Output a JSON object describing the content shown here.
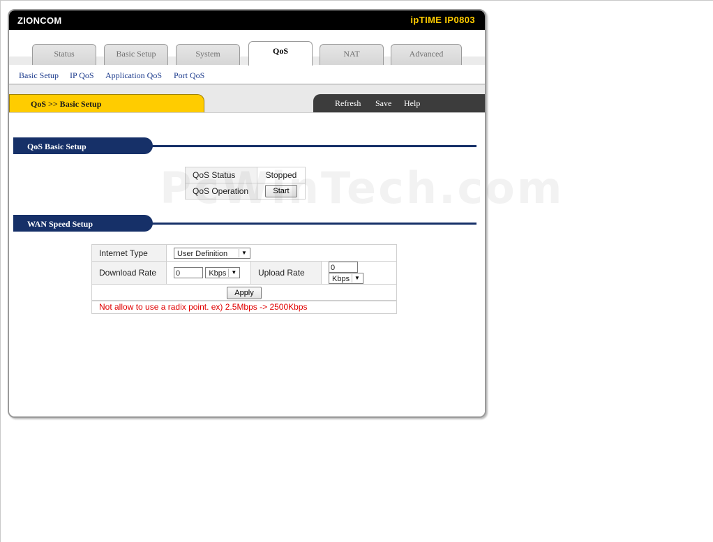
{
  "header": {
    "brand": "ZIONCOM",
    "model": "ipTIME IP0803"
  },
  "tabs": [
    "Status",
    "Basic Setup",
    "System",
    "QoS",
    "NAT",
    "Advanced"
  ],
  "active_tab": "QoS",
  "subnav": [
    "Basic Setup",
    "IP QoS",
    "Application QoS",
    "Port QoS"
  ],
  "breadcrumb": "QoS >> Basic Setup",
  "actions": {
    "refresh": "Refresh",
    "save": "Save",
    "help": "Help"
  },
  "sections": {
    "basic": "QoS Basic Setup",
    "wan": "WAN Speed Setup"
  },
  "qos_status": {
    "status_label": "QoS Status",
    "status_value": "Stopped",
    "operation_label": "QoS Operation",
    "start_button": "Start"
  },
  "wan": {
    "internet_type_label": "Internet Type",
    "internet_type_value": "User Definition",
    "download_label": "Download Rate",
    "download_value": "0",
    "download_unit": "Kbps",
    "upload_label": "Upload Rate",
    "upload_value": "0",
    "upload_unit": "Kbps",
    "apply_button": "Apply",
    "note": "Not allow to use a radix point. ex) 2.5Mbps -> 2500Kbps"
  },
  "watermark": "PcWinTech.com",
  "colors": {
    "accent_yellow": "#ffcc00",
    "section_blue": "#163068",
    "link_blue": "#1b3a8c",
    "warning_red": "#e00000"
  }
}
